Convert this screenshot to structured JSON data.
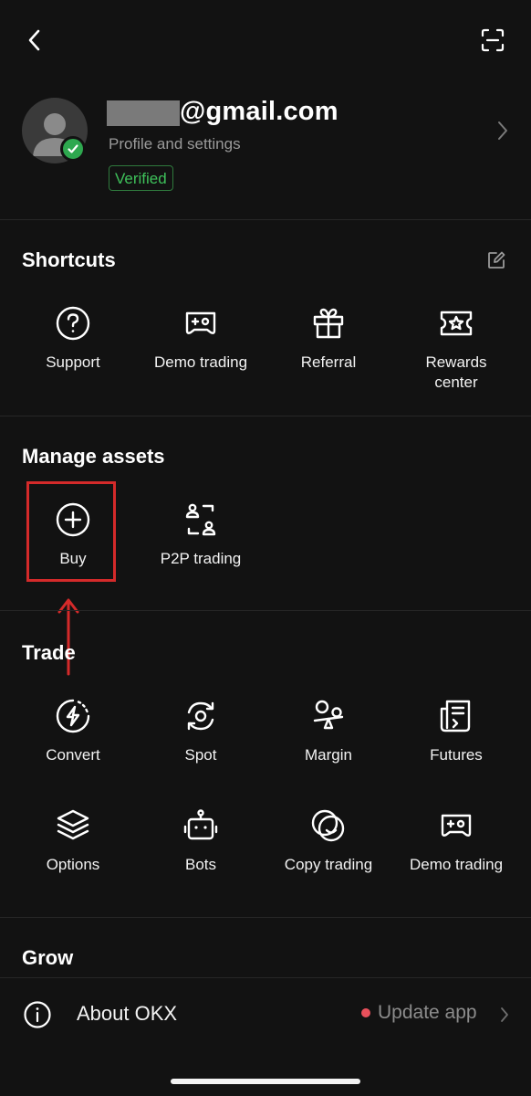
{
  "header": {
    "back_icon": "chevron-left-icon",
    "scan_icon": "scan-icon"
  },
  "profile": {
    "email_suffix": "@gmail.com",
    "subtitle": "Profile and settings",
    "badge": "Verified",
    "badge_color": "#3ec05a"
  },
  "shortcuts": {
    "title": "Shortcuts",
    "items": [
      {
        "label": "Support",
        "icon": "help-circle-icon"
      },
      {
        "label": "Demo trading",
        "icon": "gamepad-icon"
      },
      {
        "label": "Referral",
        "icon": "gift-icon"
      },
      {
        "label": "Rewards center",
        "icon": "ticket-star-icon"
      }
    ]
  },
  "manage_assets": {
    "title": "Manage assets",
    "items": [
      {
        "label": "Buy",
        "icon": "plus-circle-icon"
      },
      {
        "label": "P2P trading",
        "icon": "p2p-icon"
      }
    ]
  },
  "trade": {
    "title": "Trade",
    "items": [
      {
        "label": "Convert",
        "icon": "convert-icon"
      },
      {
        "label": "Spot",
        "icon": "spot-icon"
      },
      {
        "label": "Margin",
        "icon": "margin-icon"
      },
      {
        "label": "Futures",
        "icon": "futures-icon"
      },
      {
        "label": "Options",
        "icon": "layers-icon"
      },
      {
        "label": "Bots",
        "icon": "robot-icon"
      },
      {
        "label": "Copy trading",
        "icon": "copy-trading-icon"
      },
      {
        "label": "Demo trading",
        "icon": "gamepad-icon"
      }
    ]
  },
  "grow": {
    "title": "Grow"
  },
  "about": {
    "label": "About OKX",
    "update_label": "Update app",
    "update_dot_color": "#e8505b"
  },
  "annotation": {
    "highlight_color": "#d42a2a"
  }
}
